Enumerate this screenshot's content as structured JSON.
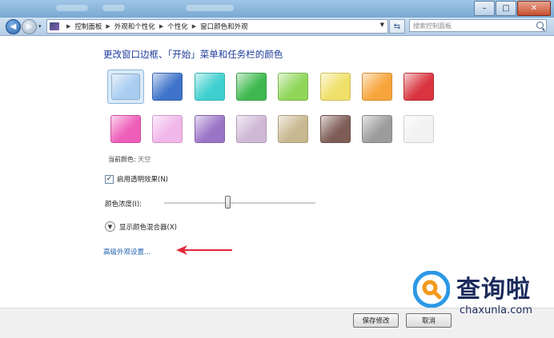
{
  "colors": {
    "heading": "#1d3a9a",
    "link": "#1f60b3",
    "accent": "#2a63a8"
  },
  "nav": {
    "breadcrumbs": [
      "控制面板",
      "外观和个性化",
      "个性化",
      "窗口颜色和外观"
    ],
    "search_placeholder": "搜索控制面板"
  },
  "main": {
    "heading": "更改窗口边框、「开始」菜单和任务栏的颜色",
    "swatches": [
      {
        "color": "#a9cdf0",
        "selected": true
      },
      {
        "color": "#3f73c9"
      },
      {
        "color": "#3fcfcf"
      },
      {
        "color": "#3fb94f"
      },
      {
        "color": "#8fd65a"
      },
      {
        "color": "#f0e06a"
      },
      {
        "color": "#f7a53b"
      },
      {
        "color": "#d9343f"
      },
      {
        "color": "#ee5db9"
      },
      {
        "color": "#f1b6ea"
      },
      {
        "color": "#9a74c6"
      },
      {
        "color": "#cfb7d6"
      },
      {
        "color": "#c8b890"
      },
      {
        "color": "#7f5d57"
      },
      {
        "color": "#9c9c9c"
      },
      {
        "color": "#f2f2f2"
      }
    ],
    "current_color_label": "当前颜色:",
    "current_color_value": "天空",
    "transparency_label": "启用透明效果(N)",
    "transparency_checked": true,
    "intensity_label": "颜色浓度(I):",
    "intensity_level": 0.42,
    "mixer_label": "显示颜色混合器(X)",
    "advanced_link": "高级外观设置..."
  },
  "footer": {
    "save_label": "保存修改",
    "cancel_label": "取消"
  },
  "watermark": {
    "text": "查询啦",
    "url": "chaxunla.com"
  }
}
